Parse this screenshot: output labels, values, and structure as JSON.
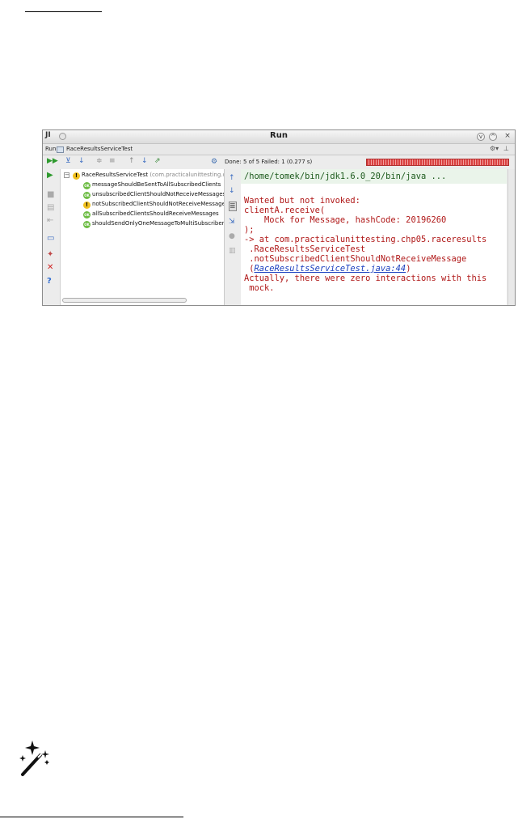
{
  "window": {
    "app_logo": "JI",
    "title": "Run",
    "min_glyph": "v",
    "max_glyph": "^",
    "close_glyph": "×"
  },
  "tabbar": {
    "run_label": "Run",
    "tab_label": "RaceResultsServiceTest",
    "settings_glyph": "⚙▾",
    "hide_glyph": "⊥"
  },
  "toolbar": {
    "status_text": "Done: 5 of 5   Failed: 1 (0.277 s)",
    "progress_fraction": 1.0
  },
  "tree": {
    "expander": "−",
    "suite_name": "RaceResultsServiceTest",
    "suite_package": "(com.practicalunittesting.chp",
    "ok_badge": "OK",
    "fail_badge": "!",
    "tests": [
      {
        "name": "messageShouldBeSentToAllSubscribedClients",
        "status": "ok"
      },
      {
        "name": "unsubscribedClientShouldNotReceiveMessages",
        "status": "ok"
      },
      {
        "name": "notSubscribedClientShouldNotReceiveMessage",
        "status": "fail"
      },
      {
        "name": "allSubscribedClientsShouldReceiveMessages",
        "status": "ok"
      },
      {
        "name": "shouldSendOnlyOneMessageToMultiSubscriber",
        "status": "ok"
      }
    ]
  },
  "console": {
    "command": "/home/tomek/bin/jdk1.6.0_20/bin/java ...",
    "line1": "Wanted but not invoked:",
    "line2": "clientA.receive(",
    "line3": "    Mock for Message, hashCode: 20196260",
    "line4": ");",
    "line5": "-> at com.practicalunittesting.chp05.raceresults",
    "line6": " .RaceResultsServiceTest",
    "line7": " .notSubscribedClientShouldNotReceiveMessage",
    "line8_prefix": " (",
    "line8_link": "RaceResultsServiceTest.java:44",
    "line8_suffix": ")",
    "line9": "Actually, there were zero interactions with this",
    "line10": " mock."
  },
  "colors": {
    "pass": "#6cbc42",
    "fail": "#f0c020",
    "error_text": "#b01818",
    "progress_red": "#d94040"
  }
}
